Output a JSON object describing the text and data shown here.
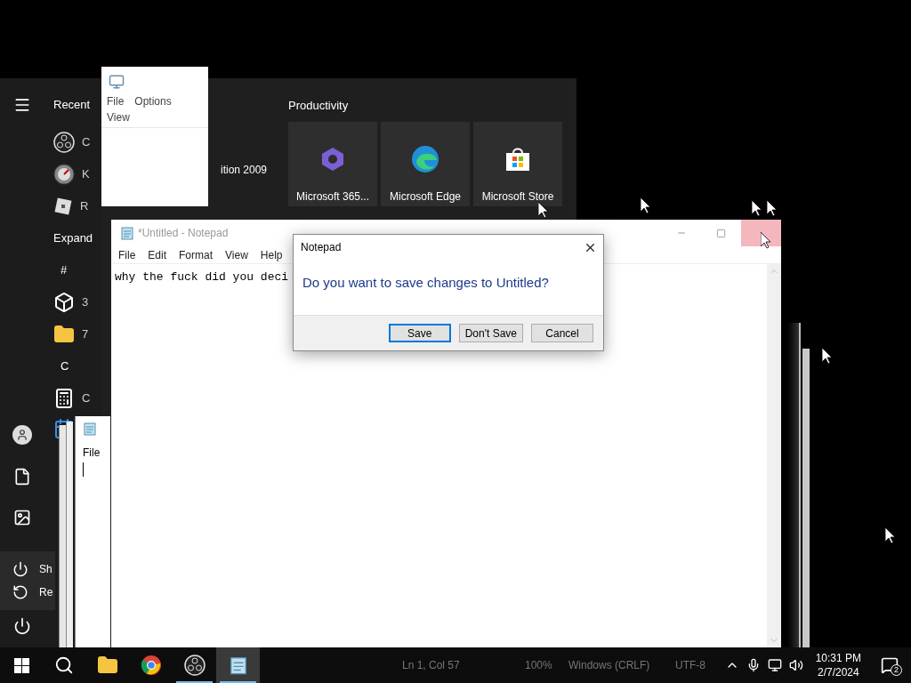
{
  "start_menu": {
    "recent_heading": "Recent",
    "recent_items": [
      {
        "label": "C"
      },
      {
        "label": "K"
      },
      {
        "label": "R"
      }
    ],
    "expand": "Expand",
    "app_list": [
      {
        "kind": "header",
        "label": "#"
      },
      {
        "kind": "app",
        "label": "3"
      },
      {
        "kind": "app",
        "label": "7"
      },
      {
        "kind": "header",
        "label": "C"
      },
      {
        "kind": "app",
        "label": "C"
      }
    ],
    "power_menu": [
      {
        "label": "Sh"
      },
      {
        "label": "Re"
      }
    ],
    "partial_tile_text": "ition 2009",
    "group_title": "Productivity",
    "tiles": [
      {
        "label": "Microsoft 365..."
      },
      {
        "label": "Microsoft Edge"
      },
      {
        "label": "Microsoft Store"
      }
    ]
  },
  "small_window": {
    "menu": [
      "File",
      "Options",
      "View"
    ]
  },
  "ghost_window": {
    "menu": [
      "File"
    ]
  },
  "notepad": {
    "title": "*Untitled - Notepad",
    "menu": [
      "File",
      "Edit",
      "Format",
      "View",
      "Help"
    ],
    "text": "why the fuck did you deci",
    "close_hovered": true,
    "status_bar": [
      "Ln 1, Col 57",
      "100%",
      "Windows (CRLF)",
      "UTF-8"
    ]
  },
  "dialog": {
    "title": "Notepad",
    "message": "Do you want to save changes to Untitled?",
    "buttons": [
      {
        "label": "Save",
        "default": true
      },
      {
        "label": "Don't Save",
        "default": false
      },
      {
        "label": "Cancel",
        "default": false
      }
    ]
  },
  "taskbar": {
    "apps": [
      {
        "running": false,
        "active": false
      },
      {
        "running": false,
        "active": false
      },
      {
        "running": true,
        "active": false
      },
      {
        "running": true,
        "active": true
      }
    ],
    "time": "10:31 PM",
    "date": "2/7/2024",
    "notifications": "2"
  }
}
